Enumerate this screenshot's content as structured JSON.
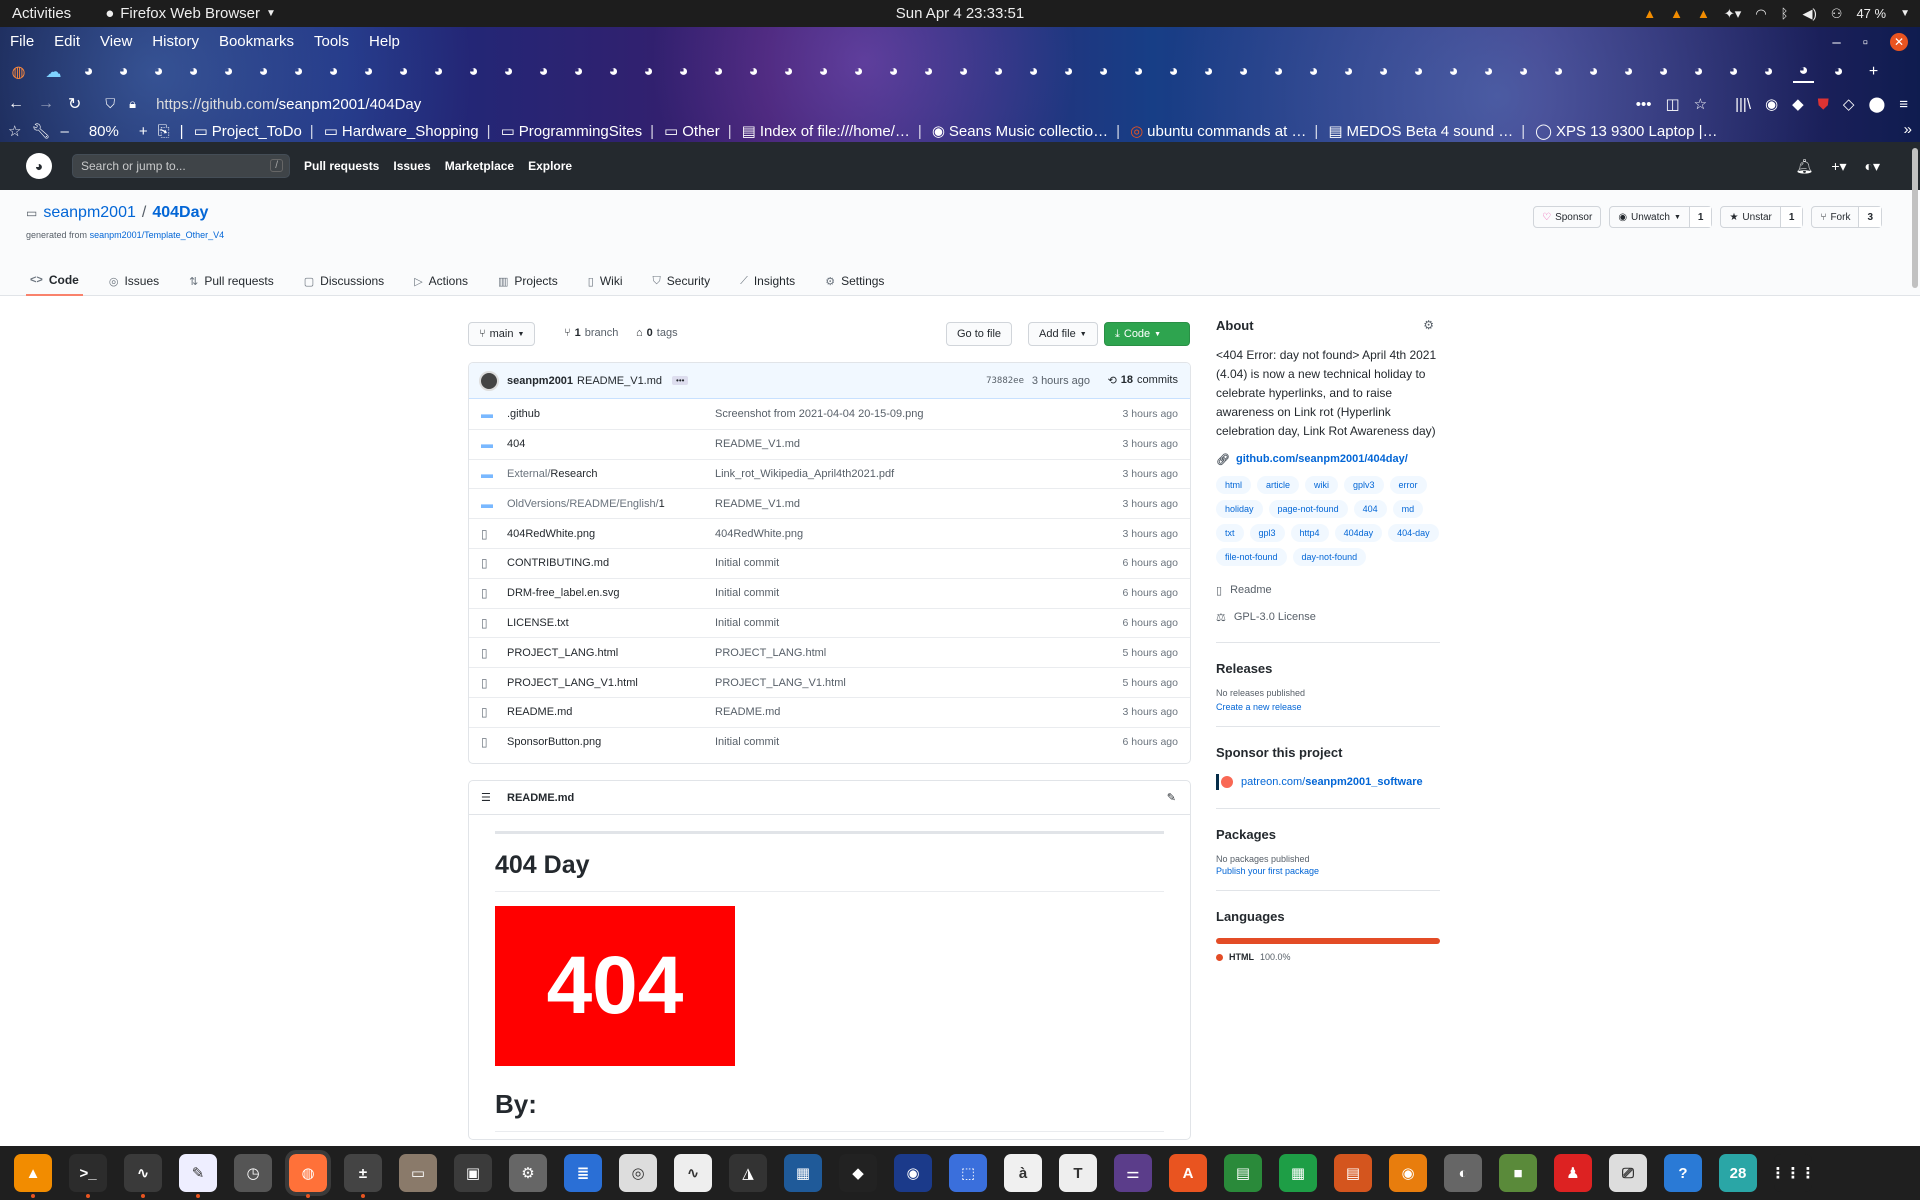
{
  "system": {
    "activities": "Activities",
    "app_name": "Firefox Web Browser",
    "clock": "Sun Apr 4  23:33:51",
    "battery": "47 %"
  },
  "firefox": {
    "menu": [
      "File",
      "Edit",
      "View",
      "History",
      "Bookmarks",
      "Tools",
      "Help"
    ],
    "url_host": "https://github.com",
    "url_path": "/seanpm2001/404Day",
    "zoom": "80%",
    "bookmarks": [
      {
        "icon": "folder",
        "label": "Project_ToDo"
      },
      {
        "icon": "folder",
        "label": "Hardware_Shopping"
      },
      {
        "icon": "folder",
        "label": "ProgrammingSites"
      },
      {
        "icon": "folder",
        "label": "Other"
      },
      {
        "icon": "page",
        "label": "Index of file:///home/…"
      },
      {
        "icon": "globe",
        "label": "Seans Music collectio…"
      },
      {
        "icon": "ubuntu",
        "label": "ubuntu commands at …"
      },
      {
        "icon": "page",
        "label": "MEDOS Beta 4 sound …"
      },
      {
        "icon": "dell",
        "label": "XPS 13 9300 Laptop |…"
      }
    ],
    "tab_count": 53
  },
  "github": {
    "search_placeholder": "Search or jump to...",
    "search_key": "/",
    "nav": [
      "Pull requests",
      "Issues",
      "Marketplace",
      "Explore"
    ],
    "owner": "seanpm2001",
    "repo": "404Day",
    "generated_from_label": "generated from",
    "generated_from": "seanpm2001/Template_Other_V4",
    "sponsor_label": "Sponsor",
    "unwatch_label": "Unwatch",
    "unwatch_count": "1",
    "unstar_label": "Unstar",
    "star_count": "1",
    "fork_label": "Fork",
    "fork_count": "3",
    "tabs": [
      "Code",
      "Issues",
      "Pull requests",
      "Discussions",
      "Actions",
      "Projects",
      "Wiki",
      "Security",
      "Insights",
      "Settings"
    ],
    "branch": "main",
    "branches_count": "1",
    "branches_label": "branch",
    "tags_count": "0",
    "tags_label": "tags",
    "go_to_file": "Go to file",
    "add_file": "Add file",
    "code_btn": "Code",
    "commit": {
      "author": "seanpm2001",
      "message": "README_V1.md",
      "sha": "73882ee",
      "age": "3 hours ago",
      "commits_count": "18",
      "commits_label": "commits"
    },
    "files": [
      {
        "type": "dir",
        "prefix": "",
        "name": ".github",
        "msg": "Screenshot from 2021-04-04 20-15-09.png",
        "age": "3 hours ago"
      },
      {
        "type": "dir",
        "prefix": "",
        "name": "404",
        "msg": "README_V1.md",
        "age": "3 hours ago"
      },
      {
        "type": "dir",
        "prefix": "External/",
        "name": "Research",
        "msg": "Link_rot_Wikipedia_April4th2021.pdf",
        "age": "3 hours ago"
      },
      {
        "type": "dir",
        "prefix": "OldVersions/README/English/",
        "name": "1",
        "msg": "README_V1.md",
        "age": "3 hours ago"
      },
      {
        "type": "file",
        "prefix": "",
        "name": "404RedWhite.png",
        "msg": "404RedWhite.png",
        "age": "3 hours ago"
      },
      {
        "type": "file",
        "prefix": "",
        "name": "CONTRIBUTING.md",
        "msg": "Initial commit",
        "age": "6 hours ago"
      },
      {
        "type": "file",
        "prefix": "",
        "name": "DRM-free_label.en.svg",
        "msg": "Initial commit",
        "age": "6 hours ago"
      },
      {
        "type": "file",
        "prefix": "",
        "name": "LICENSE.txt",
        "msg": "Initial commit",
        "age": "6 hours ago"
      },
      {
        "type": "file",
        "prefix": "",
        "name": "PROJECT_LANG.html",
        "msg": "PROJECT_LANG.html",
        "age": "5 hours ago"
      },
      {
        "type": "file",
        "prefix": "",
        "name": "PROJECT_LANG_V1.html",
        "msg": "PROJECT_LANG_V1.html",
        "age": "5 hours ago"
      },
      {
        "type": "file",
        "prefix": "",
        "name": "README.md",
        "msg": "README.md",
        "age": "3 hours ago"
      },
      {
        "type": "file",
        "prefix": "",
        "name": "SponsorButton.png",
        "msg": "Initial commit",
        "age": "6 hours ago"
      }
    ],
    "readme": {
      "filename": "README.md",
      "h1": "404 Day",
      "image_text": "404",
      "h2": "By:"
    },
    "about": {
      "title": "About",
      "description": "<404 Error: day not found> April 4th 2021 (4.04) is now a new technical holiday to celebrate hyperlinks, and to raise awareness on Link rot (Hyperlink celebration day, Link Rot Awareness day)",
      "link": "github.com/seanpm2001/404day/",
      "topics": [
        "html",
        "article",
        "wiki",
        "gplv3",
        "error",
        "holiday",
        "page-not-found",
        "404",
        "md",
        "txt",
        "gpl3",
        "http4",
        "404day",
        "404-day",
        "file-not-found",
        "day-not-found"
      ],
      "readme": "Readme",
      "license": "GPL-3.0 License"
    },
    "releases": {
      "title": "Releases",
      "none": "No releases published",
      "create": "Create a new release"
    },
    "sponsor": {
      "title": "Sponsor this project",
      "link_host": "patreon.com/",
      "link_path": "seanpm2001_software"
    },
    "packages": {
      "title": "Packages",
      "none": "No packages published",
      "publish": "Publish your first package"
    },
    "languages": {
      "title": "Languages",
      "name": "HTML",
      "pct": "100.0%",
      "color": "#e34c26"
    }
  },
  "dock": [
    "vlc",
    "terminal",
    "system-monitor",
    "text-editor",
    "clock",
    "firefox",
    "calculator",
    "files",
    "minecraft-launcher",
    "settings",
    "writer",
    "image-viewer",
    "sound-recorder",
    "inkscape",
    "virtualbox",
    "gimp",
    "audacity",
    "screenshot",
    "accents",
    "typora",
    "tweaks",
    "software",
    "gnumeric",
    "calc",
    "impress",
    "blender",
    "gimp2",
    "minecraft",
    "mario",
    "scanner",
    "help",
    "calendar-28",
    "app-grid"
  ]
}
